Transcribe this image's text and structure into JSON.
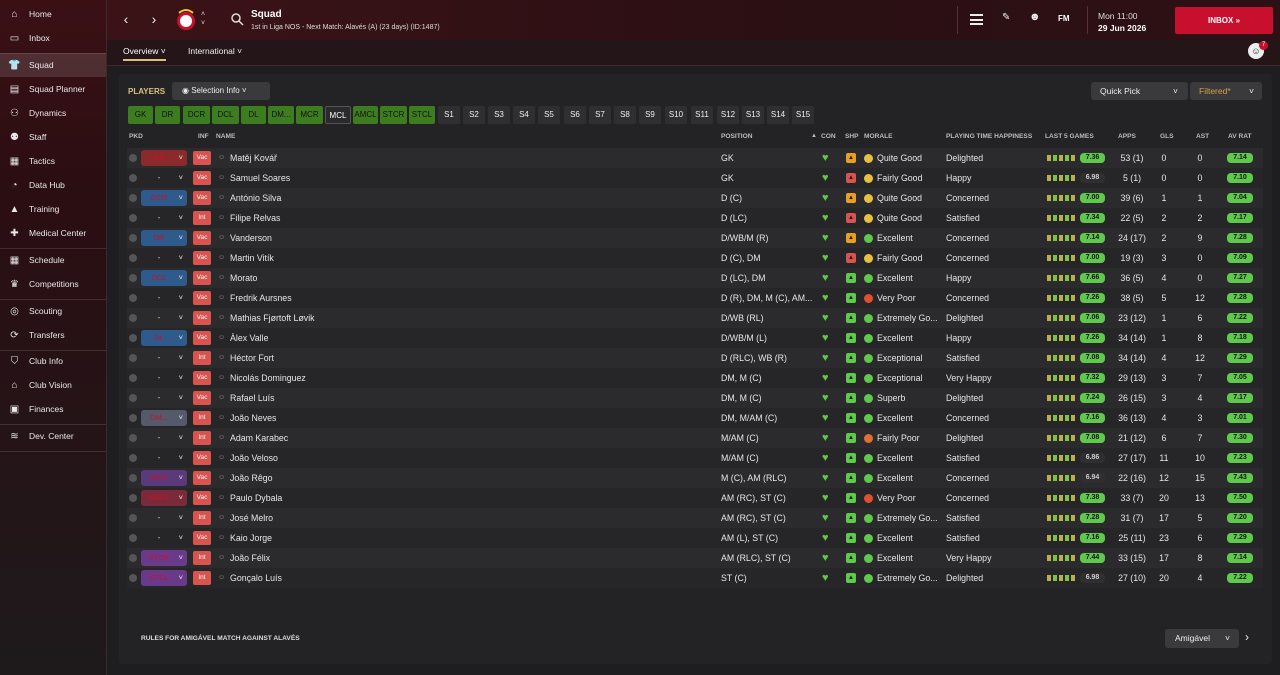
{
  "sidebar": {
    "items": [
      {
        "label": "Home",
        "icon": "home-icon"
      },
      {
        "label": "Inbox",
        "icon": "inbox-icon"
      },
      {
        "label": "Squad",
        "icon": "shirt-icon"
      },
      {
        "label": "Squad Planner",
        "icon": "planner-icon"
      },
      {
        "label": "Dynamics",
        "icon": "dynamics-icon"
      },
      {
        "label": "Staff",
        "icon": "staff-icon"
      },
      {
        "label": "Tactics",
        "icon": "tactics-icon"
      },
      {
        "label": "Data Hub",
        "icon": "datahub-icon"
      },
      {
        "label": "Training",
        "icon": "training-icon"
      },
      {
        "label": "Medical Center",
        "icon": "medical-icon"
      },
      {
        "label": "Schedule",
        "icon": "calendar-icon"
      },
      {
        "label": "Competitions",
        "icon": "trophy-icon"
      },
      {
        "label": "Scouting",
        "icon": "scouting-icon"
      },
      {
        "label": "Transfers",
        "icon": "transfers-icon"
      },
      {
        "label": "Club Info",
        "icon": "shield-icon"
      },
      {
        "label": "Club Vision",
        "icon": "vision-icon"
      },
      {
        "label": "Finances",
        "icon": "finances-icon"
      },
      {
        "label": "Dev. Center",
        "icon": "devcenter-icon"
      }
    ]
  },
  "header": {
    "title": "Squad",
    "subtitle": "1st in Liga NOS - Next Match: Alavés (A) (23 days) (ID:1487)",
    "fm": "FM",
    "day": "Mon 11:00",
    "date": "29 Jun 2026",
    "inbox": "INBOX",
    "notif_count": "7"
  },
  "subnav": {
    "tabs": [
      "Overview",
      "International"
    ]
  },
  "toolbar": {
    "players": "PLAYERS",
    "selection": "Selection Info",
    "quick_pick": "Quick Pick",
    "filtered": "Filtered*"
  },
  "positions": [
    "GK",
    "DR",
    "DCR",
    "DCL",
    "DL",
    "DM...",
    "MCR",
    "MCL",
    "AMCL",
    "STCR",
    "STCL",
    "S1",
    "S2",
    "S3",
    "S4",
    "S5",
    "S6",
    "S7",
    "S8",
    "S9",
    "S10",
    "S11",
    "S12",
    "S13",
    "S14",
    "S15"
  ],
  "columns": [
    "PKD",
    "INF",
    "NAME",
    "POSITION",
    "CON",
    "SHP",
    "MORALE",
    "PLAYING TIME HAPPINESS",
    "LAST 5 GAMES",
    "APPS",
    "GLS",
    "AST",
    "AV RAT"
  ],
  "players": [
    {
      "pkd": "GK",
      "inf": "Vac",
      "name": "Matěj Kovář",
      "position": "GK",
      "morale": "Quite Good",
      "pth": "Delighted",
      "l5": "7.36",
      "apps": "53 (1)",
      "gls": "0",
      "ast": "0",
      "rat": "7.14"
    },
    {
      "pkd": "-",
      "inf": "Vac",
      "name": "Samuel Soares",
      "position": "GK",
      "morale": "Fairly Good",
      "pth": "Happy",
      "l5": "6.98",
      "apps": "5 (1)",
      "gls": "0",
      "ast": "0",
      "rat": "7.10"
    },
    {
      "pkd": "DCR",
      "inf": "Vac",
      "name": "António Silva",
      "position": "D (C)",
      "morale": "Quite Good",
      "pth": "Concerned",
      "l5": "7.00",
      "apps": "39 (6)",
      "gls": "1",
      "ast": "1",
      "rat": "7.04"
    },
    {
      "pkd": "-",
      "inf": "Int",
      "name": "Filipe Relvas",
      "position": "D (LC)",
      "morale": "Quite Good",
      "pth": "Satisfied",
      "l5": "7.34",
      "apps": "22 (5)",
      "gls": "2",
      "ast": "2",
      "rat": "7.17"
    },
    {
      "pkd": "DR",
      "inf": "Vac",
      "name": "Vanderson",
      "position": "D/WB/M (R)",
      "morale": "Excellent",
      "pth": "Concerned",
      "l5": "7.14",
      "apps": "24 (17)",
      "gls": "2",
      "ast": "9",
      "rat": "7.28"
    },
    {
      "pkd": "-",
      "inf": "Vac",
      "name": "Martin Vitík",
      "position": "D (C), DM",
      "morale": "Fairly Good",
      "pth": "Concerned",
      "l5": "7.00",
      "apps": "19 (3)",
      "gls": "3",
      "ast": "0",
      "rat": "7.09"
    },
    {
      "pkd": "DCL",
      "inf": "Vac",
      "name": "Morato",
      "position": "D (LC), DM",
      "morale": "Excellent",
      "pth": "Happy",
      "l5": "7.66",
      "apps": "36 (5)",
      "gls": "4",
      "ast": "0",
      "rat": "7.27"
    },
    {
      "pkd": "-",
      "inf": "Vac",
      "name": "Fredrik Aursnes",
      "position": "D (R), DM, M (C), AM...",
      "morale": "Very Poor",
      "pth": "Concerned",
      "l5": "7.26",
      "apps": "38 (5)",
      "gls": "5",
      "ast": "12",
      "rat": "7.28"
    },
    {
      "pkd": "-",
      "inf": "Vac",
      "name": "Mathias Fjørtoft Løvik",
      "position": "D/WB (RL)",
      "morale": "Extremely Go...",
      "pth": "Delighted",
      "l5": "7.06",
      "apps": "23 (12)",
      "gls": "1",
      "ast": "6",
      "rat": "7.22"
    },
    {
      "pkd": "DL",
      "inf": "Vac",
      "name": "Àlex Valle",
      "position": "D/WB/M (L)",
      "morale": "Excellent",
      "pth": "Happy",
      "l5": "7.26",
      "apps": "34 (14)",
      "gls": "1",
      "ast": "8",
      "rat": "7.18"
    },
    {
      "pkd": "-",
      "inf": "Int",
      "name": "Héctor Fort",
      "position": "D (RLC), WB (R)",
      "morale": "Exceptional",
      "pth": "Satisfied",
      "l5": "7.08",
      "apps": "34 (14)",
      "gls": "4",
      "ast": "12",
      "rat": "7.29"
    },
    {
      "pkd": "-",
      "inf": "Vac",
      "name": "Nicolás Dominguez",
      "position": "DM, M (C)",
      "morale": "Exceptional",
      "pth": "Very Happy",
      "l5": "7.32",
      "apps": "29 (13)",
      "gls": "3",
      "ast": "7",
      "rat": "7.05"
    },
    {
      "pkd": "-",
      "inf": "Vac",
      "name": "Rafael Luís",
      "position": "DM, M (C)",
      "morale": "Superb",
      "pth": "Delighted",
      "l5": "7.24",
      "apps": "26 (15)",
      "gls": "3",
      "ast": "4",
      "rat": "7.17"
    },
    {
      "pkd": "DM...",
      "inf": "Int",
      "name": "João Neves",
      "position": "DM, M/AM (C)",
      "morale": "Excellent",
      "pth": "Concerned",
      "l5": "7.16",
      "apps": "36 (13)",
      "gls": "4",
      "ast": "3",
      "rat": "7.01"
    },
    {
      "pkd": "-",
      "inf": "Int",
      "name": "Adam Karabec",
      "position": "M/AM (C)",
      "morale": "Fairly Poor",
      "pth": "Delighted",
      "l5": "7.08",
      "apps": "21 (12)",
      "gls": "6",
      "ast": "7",
      "rat": "7.30"
    },
    {
      "pkd": "-",
      "inf": "Vac",
      "name": "João Veloso",
      "position": "M/AM (C)",
      "morale": "Excellent",
      "pth": "Satisfied",
      "l5": "6.86",
      "apps": "27 (17)",
      "gls": "11",
      "ast": "10",
      "rat": "7.23"
    },
    {
      "pkd": "MCR",
      "inf": "Vac",
      "name": "João Rêgo",
      "position": "M (C), AM (RLC)",
      "morale": "Excellent",
      "pth": "Concerned",
      "l5": "6.94",
      "apps": "22 (16)",
      "gls": "12",
      "ast": "15",
      "rat": "7.43"
    },
    {
      "pkd": "AMCL",
      "inf": "Vac",
      "name": "Paulo Dybala",
      "position": "AM (RC), ST (C)",
      "morale": "Very Poor",
      "pth": "Concerned",
      "l5": "7.38",
      "apps": "33 (7)",
      "gls": "20",
      "ast": "13",
      "rat": "7.50"
    },
    {
      "pkd": "-",
      "inf": "Int",
      "name": "José Melro",
      "position": "AM (RC), ST (C)",
      "morale": "Extremely Go...",
      "pth": "Satisfied",
      "l5": "7.28",
      "apps": "31 (7)",
      "gls": "17",
      "ast": "5",
      "rat": "7.20"
    },
    {
      "pkd": "-",
      "inf": "Vac",
      "name": "Kaio Jorge",
      "position": "AM (L), ST (C)",
      "morale": "Excellent",
      "pth": "Satisfied",
      "l5": "7.16",
      "apps": "25 (11)",
      "gls": "23",
      "ast": "6",
      "rat": "7.29"
    },
    {
      "pkd": "STCR",
      "inf": "Int",
      "name": "João Félix",
      "position": "AM (RLC), ST (C)",
      "morale": "Excellent",
      "pth": "Very Happy",
      "l5": "7.44",
      "apps": "33 (15)",
      "gls": "17",
      "ast": "8",
      "rat": "7.14"
    },
    {
      "pkd": "STCL",
      "inf": "Int",
      "name": "Gonçalo Luís",
      "position": "ST (C)",
      "morale": "Extremely Go...",
      "pth": "Delighted",
      "l5": "6.98",
      "apps": "27 (10)",
      "gls": "20",
      "ast": "4",
      "rat": "7.22"
    }
  ],
  "footer": {
    "rules": "RULES FOR AMIGÁVEL MATCH AGAINST ALAVÉS",
    "dropdown": "Amigável"
  }
}
